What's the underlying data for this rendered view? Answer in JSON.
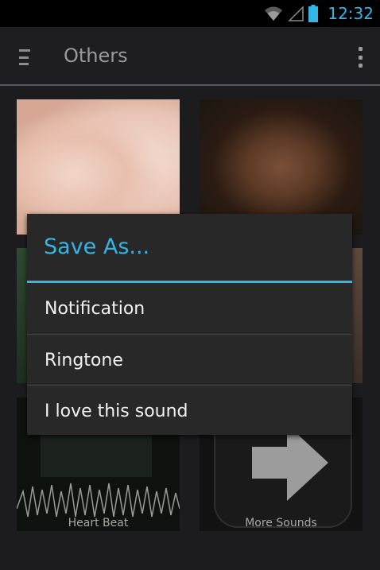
{
  "status_bar": {
    "time": "12:32",
    "icons": [
      "wifi-icon",
      "signal-icon",
      "battery-icon"
    ],
    "accent_color": "#33b5e5"
  },
  "action_bar": {
    "title": "Others",
    "icons": [
      "menu-icon",
      "overflow-menu-icon"
    ]
  },
  "grid": {
    "tiles": [
      {
        "label": ""
      },
      {
        "label": ""
      },
      {
        "label": ""
      },
      {
        "label": ""
      },
      {
        "label": "Heart Beat"
      },
      {
        "label": "More Sounds"
      }
    ]
  },
  "dialog": {
    "title": "Save As...",
    "items": [
      {
        "label": "Notification"
      },
      {
        "label": "Ringtone"
      },
      {
        "label": "I love this sound"
      }
    ]
  }
}
